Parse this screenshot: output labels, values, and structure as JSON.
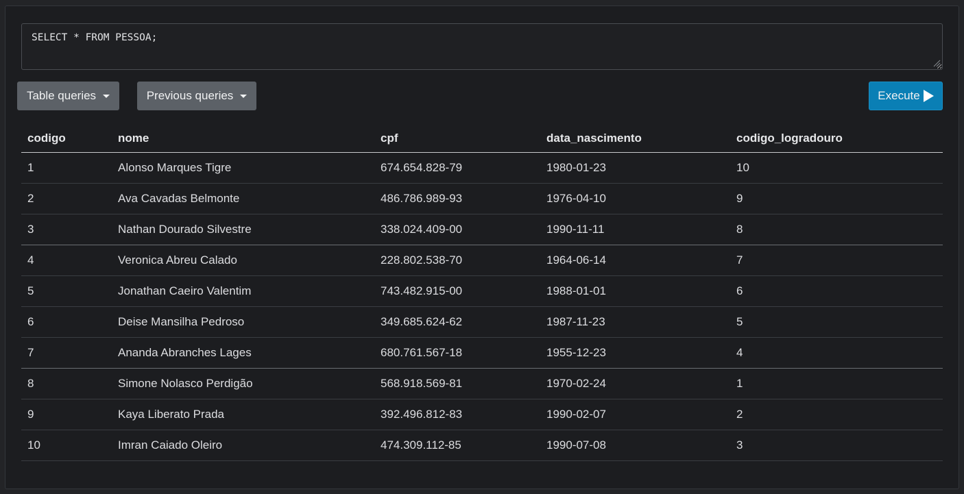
{
  "editor": {
    "query": "SELECT * FROM PESSOA;"
  },
  "toolbar": {
    "table_queries_label": "Table queries",
    "previous_queries_label": "Previous queries",
    "execute_label": "Execute"
  },
  "icons": {
    "dropdown": "caret-down-icon",
    "execute": "play-icon"
  },
  "colors": {
    "background": "#1c1d20",
    "secondary_button": "#5c6167",
    "primary_button": "#0a7fb5",
    "text": "#dcdde0"
  },
  "table": {
    "headers": [
      "codigo",
      "nome",
      "cpf",
      "data_nascimento",
      "codigo_logradouro"
    ],
    "rows": [
      [
        "1",
        "Alonso Marques Tigre",
        "674.654.828-79",
        "1980-01-23",
        "10"
      ],
      [
        "2",
        "Ava Cavadas Belmonte",
        "486.786.989-93",
        "1976-04-10",
        "9"
      ],
      [
        "3",
        "Nathan Dourado Silvestre",
        "338.024.409-00",
        "1990-11-11",
        "8"
      ],
      [
        "4",
        "Veronica Abreu Calado",
        "228.802.538-70",
        "1964-06-14",
        "7"
      ],
      [
        "5",
        "Jonathan Caeiro Valentim",
        "743.482.915-00",
        "1988-01-01",
        "6"
      ],
      [
        "6",
        "Deise Mansilha Pedroso",
        "349.685.624-62",
        "1987-11-23",
        "5"
      ],
      [
        "7",
        "Ananda Abranches Lages",
        "680.761.567-18",
        "1955-12-23",
        "4"
      ],
      [
        "8",
        "Simone Nolasco Perdigão",
        "568.918.569-81",
        "1970-02-24",
        "1"
      ],
      [
        "9",
        "Kaya Liberato Prada",
        "392.496.812-83",
        "1990-02-07",
        "2"
      ],
      [
        "10",
        "Imran Caiado Oleiro",
        "474.309.112-85",
        "1990-07-08",
        "3"
      ]
    ]
  }
}
